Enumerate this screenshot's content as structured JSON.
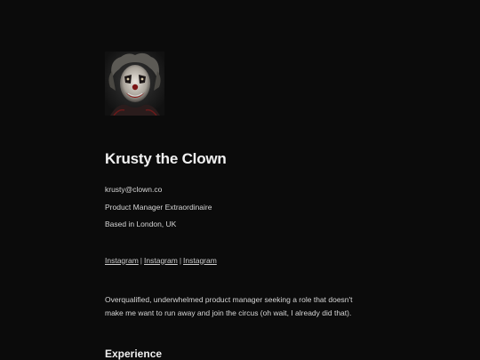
{
  "profile": {
    "name": "Krusty the Clown",
    "email": "krusty@clown.co",
    "title": "Product Manager Extraordinaire",
    "location": "Based in London, UK",
    "links": [
      "Instagram",
      "Instagram",
      "Instagram"
    ],
    "link_separator": "|",
    "bio": "Overqualified, underwhelmed product manager seeking a role that doesn't make me want to run away and join the circus (oh wait, I already did that).",
    "avatar_icon": "clown-portrait"
  },
  "sections": {
    "experience_heading": "Experience"
  },
  "colors": {
    "background": "#0b0b0b",
    "text": "#e8e8e8"
  }
}
